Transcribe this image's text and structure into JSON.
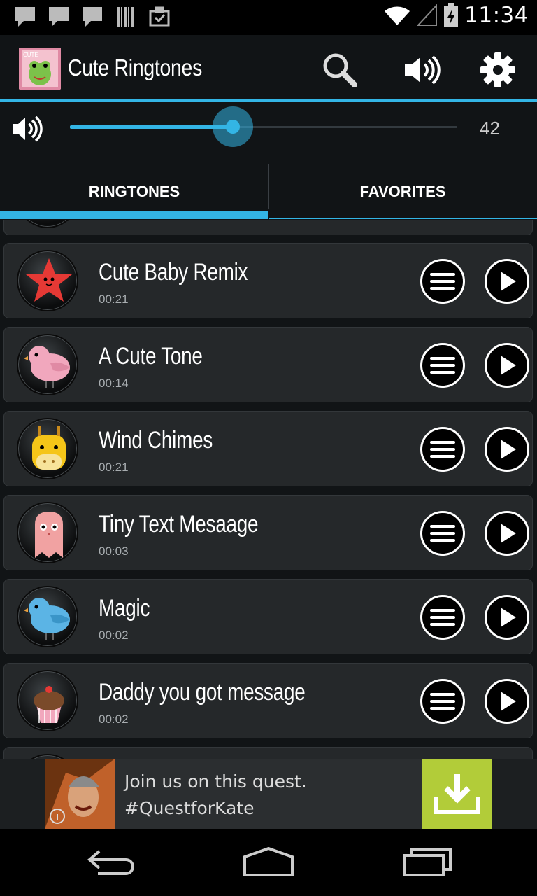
{
  "status_bar": {
    "time": "11:34",
    "notification_icons": [
      "message-icon",
      "message-icon",
      "message-icon",
      "barcode-icon",
      "clipboard-check-icon"
    ],
    "wifi_icon": "wifi-icon",
    "signal_icon": "signal-icon",
    "battery_icon": "battery-charging-icon"
  },
  "action_bar": {
    "title": "Cute Ringtones",
    "icon_label": "CUTE",
    "search_icon": "search-icon",
    "volume_icon": "volume-icon",
    "settings_icon": "gear-icon"
  },
  "volume": {
    "value": "42",
    "level_fraction": 0.42
  },
  "tabs": [
    {
      "label": "RINGTONES",
      "selected": true
    },
    {
      "label": "FAVORITES",
      "selected": false
    }
  ],
  "ringtones": [
    {
      "title": "Cute Baby Remix",
      "duration": "00:21",
      "avatar": "starfish-avatar"
    },
    {
      "title": "A Cute Tone",
      "duration": "00:14",
      "avatar": "pink-bird-avatar"
    },
    {
      "title": "Wind Chimes",
      "duration": "00:21",
      "avatar": "giraffe-avatar"
    },
    {
      "title": "Tiny Text Mesaage",
      "duration": "00:03",
      "avatar": "pink-ghost-avatar"
    },
    {
      "title": "Magic",
      "duration": "00:02",
      "avatar": "blue-bird-avatar"
    },
    {
      "title": "Daddy you got message",
      "duration": "00:02",
      "avatar": "cupcake-avatar"
    }
  ],
  "ad": {
    "line1": "Join us on this quest.",
    "line2": "#QuestforKate",
    "download_icon": "download-icon"
  },
  "nav_bar": {
    "back_icon": "back-icon",
    "home_icon": "home-icon",
    "recents_icon": "recents-icon"
  },
  "colors": {
    "accent": "#33b5e5",
    "row_bg": "#25282a",
    "ad_green": "#b2cc39"
  }
}
